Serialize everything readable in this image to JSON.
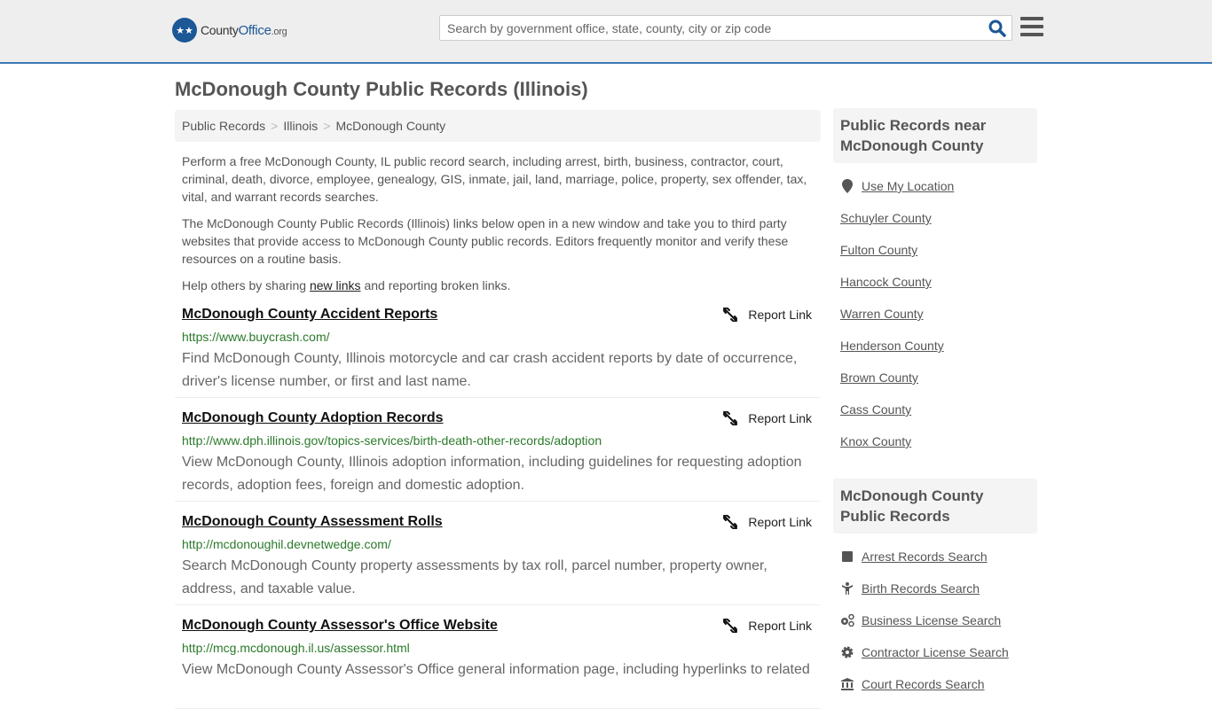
{
  "header": {
    "logo_text_1": "County",
    "logo_text_2": "Office",
    "logo_text_3": ".org",
    "search_placeholder": "Search by government office, state, county, city or zip code",
    "search_icon": "search-icon",
    "menu_icon": "hamburger-menu-icon"
  },
  "page": {
    "title": "McDonough County Public Records (Illinois)"
  },
  "breadcrumb": [
    {
      "label": "Public Records"
    },
    {
      "label": "Illinois"
    },
    {
      "label": "McDonough County"
    }
  ],
  "breadcrumb_sep": ">",
  "intro": {
    "p1": "Perform a free McDonough County, IL public record search, including arrest, birth, business, contractor, court, criminal, death, divorce, employee, genealogy, GIS, inmate, jail, land, marriage, police, property, sex offender, tax, vital, and warrant records searches.",
    "p2": "The McDonough County Public Records (Illinois) links below open in a new window and take you to third party websites that provide access to McDonough County public records. Editors frequently monitor and verify these resources on a routine basis.",
    "p3_before": "Help others by sharing ",
    "p3_link": "new links",
    "p3_after": " and reporting broken links."
  },
  "report_label": "Report Link",
  "records": [
    {
      "title": "McDonough County Accident Reports",
      "url": "https://www.buycrash.com/",
      "desc": "Find McDonough County, Illinois motorcycle and car crash accident reports by date of occurrence, driver's license number, or first and last name."
    },
    {
      "title": "McDonough County Adoption Records",
      "url": "http://www.dph.illinois.gov/topics-services/birth-death-other-records/adoption",
      "desc": "View McDonough County, Illinois adoption information, including guidelines for requesting adoption records, adoption fees, foreign and domestic adoption."
    },
    {
      "title": "McDonough County Assessment Rolls",
      "url": "http://mcdonoughil.devnetwedge.com/",
      "desc": "Search McDonough County property assessments by tax roll, parcel number, property owner, address, and taxable value."
    },
    {
      "title": "McDonough County Assessor's Office Website",
      "url": "http://mcg.mcdonough.il.us/assessor.html",
      "desc": "View McDonough County Assessor's Office general information page, including hyperlinks to related"
    }
  ],
  "sidebar": {
    "nearby_title": "Public Records near McDonough County",
    "use_location": "Use My Location",
    "nearby": [
      {
        "label": "Schuyler County"
      },
      {
        "label": "Fulton County"
      },
      {
        "label": "Hancock County"
      },
      {
        "label": "Warren County"
      },
      {
        "label": "Henderson County"
      },
      {
        "label": "Brown County"
      },
      {
        "label": "Cass County"
      },
      {
        "label": "Knox County"
      }
    ],
    "records_title": "McDonough County Public Records",
    "record_links": [
      {
        "label": "Arrest Records Search",
        "icon": "square-icon"
      },
      {
        "label": "Birth Records Search",
        "icon": "child-icon"
      },
      {
        "label": "Business License Search",
        "icon": "gears-icon"
      },
      {
        "label": "Contractor License Search",
        "icon": "gear-icon"
      },
      {
        "label": "Court Records Search",
        "icon": "courthouse-icon"
      }
    ]
  }
}
